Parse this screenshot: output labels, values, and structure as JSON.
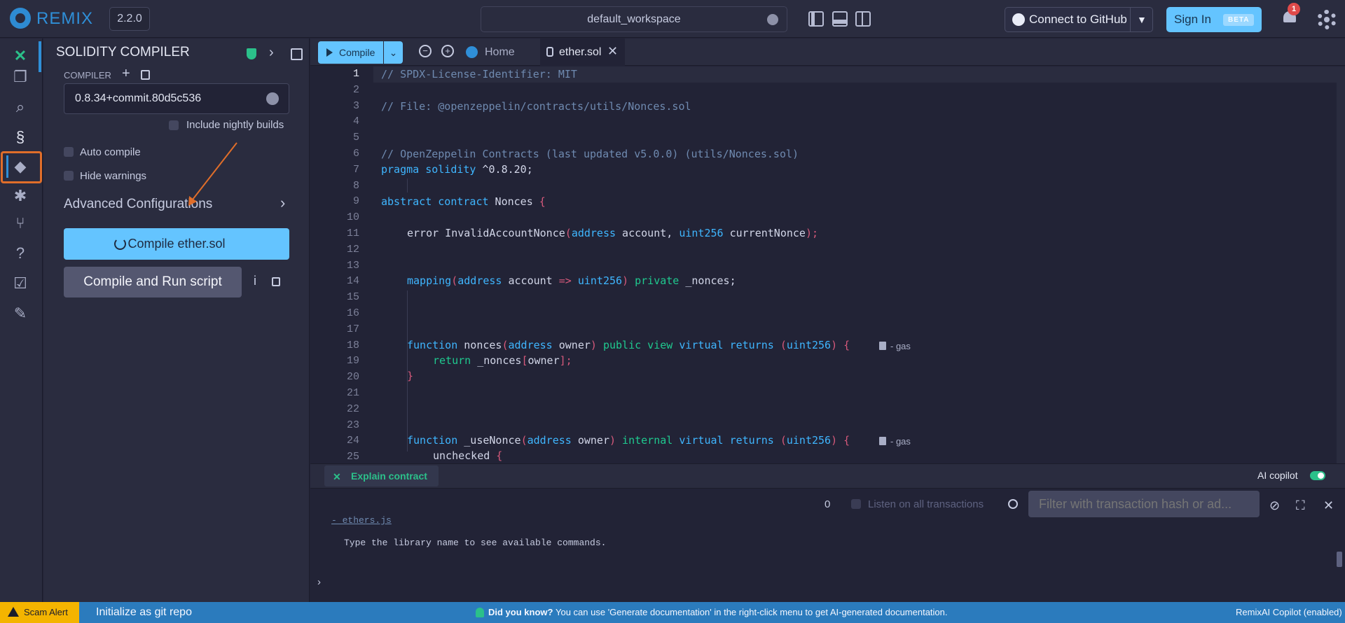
{
  "app": {
    "brand": "REMIX",
    "version": "2.2.0",
    "workspace": "default_workspace"
  },
  "header": {
    "github_label": "Connect to GitHub",
    "signin_label": "Sign In",
    "signin_badge": "BETA",
    "notification_count": "1"
  },
  "rail": {
    "icons": [
      "remix-ai-icon",
      "file-explorer-icon",
      "search-icon",
      "solidity-compiler-icon",
      "deploy-run-icon",
      "debugger-icon",
      "git-icon",
      "help-icon",
      "verify-icon",
      "plugin-manager-icon"
    ],
    "active_index": 3
  },
  "panel": {
    "title": "SOLIDITY COMPILER",
    "compiler_label": "COMPILER",
    "compiler_version": "0.8.34+commit.80d5c536",
    "nightly_label": "Include nightly builds",
    "auto_compile_label": "Auto compile",
    "hide_warnings_label": "Hide warnings",
    "advanced_label": "Advanced Configurations",
    "compile_button": "Compile ether.sol",
    "run_script_button": "Compile and Run script",
    "info_label": "i"
  },
  "editor": {
    "compile_label": "Compile",
    "tabs": [
      {
        "label": "Home"
      },
      {
        "label": "ether.sol",
        "close": "✕"
      }
    ],
    "line_numbers": [
      "1",
      "2",
      "3",
      "4",
      "5",
      "6",
      "7",
      "8",
      "9",
      "10",
      "11",
      "12",
      "13",
      "14",
      "15",
      "16",
      "17",
      "18",
      "19",
      "20",
      "21",
      "22",
      "23",
      "24",
      "25"
    ],
    "lines": {
      "l1": "// SPDX-License-Identifier: MIT",
      "l3": "// File: @openzeppelin/contracts/utils/Nonces.sol",
      "l6": "// OpenZeppelin Contracts (last updated v5.0.0) (utils/Nonces.sol)",
      "l7_kw": "pragma solidity",
      "l7_ver": " ^0.8.20;",
      "l9_kw": "abstract contract",
      "l9_id": " Nonces ",
      "l9_brace": "{",
      "l11_a": "error InvalidAccountNonce",
      "l11_b": "(",
      "l11_c": "address",
      "l11_d": " account, ",
      "l11_e": "uint256",
      "l11_f": " currentNonce",
      "l11_g": ");",
      "l14_a": "mapping",
      "l14_b": "(",
      "l14_c": "address",
      "l14_d": " account ",
      "l14_e": "=>",
      "l14_f": " uint256",
      "l14_g": ")",
      "l14_h": " private",
      "l14_i": " _nonces;",
      "l18_a": "function",
      "l18_b": " nonces",
      "l18_c": "(",
      "l18_d": "address",
      "l18_e": " owner",
      "l18_f": ")",
      "l18_g": " public view",
      "l18_h": " virtual returns",
      "l18_i": " (",
      "l18_j": "uint256",
      "l18_k": ")",
      "l18_l": " {",
      "l19_a": "return",
      "l19_b": " _nonces",
      "l19_c": "[",
      "l19_d": "owner",
      "l19_e": "];",
      "l20": "}",
      "l24_a": "function",
      "l24_b": " _useNonce",
      "l24_c": "(",
      "l24_d": "address",
      "l24_e": " owner",
      "l24_f": ")",
      "l24_g": " internal",
      "l24_h": " virtual returns",
      "l24_i": " (",
      "l24_j": "uint256",
      "l24_k": ")",
      "l24_l": " {",
      "l25_a": "unchecked",
      "l25_b": " {"
    },
    "gas_label": "- gas"
  },
  "bottom": {
    "explain_label": "Explain contract",
    "ai_copilot_label": "AI copilot",
    "tx_count": "0",
    "listen_label": "Listen on all transactions",
    "filter_placeholder": "Filter with transaction hash or ad...",
    "terminal_lines": [
      "- ethers.js",
      "Type the library name to see available commands."
    ],
    "prompt": "›"
  },
  "status": {
    "scam_alert": "Scam Alert",
    "git_init": "Initialize as git repo",
    "did_you_know": "Did you know?",
    "tip": "You can use 'Generate documentation' in the right-click menu to get AI-generated documentation.",
    "copilot": "RemixAI Copilot (enabled)"
  },
  "colors": {
    "accent": "#64c4ff",
    "brand": "#2f8fd8",
    "highlight_box": "#e06e2a",
    "status_bar": "#2b7bbd",
    "scam": "#f4b400"
  }
}
